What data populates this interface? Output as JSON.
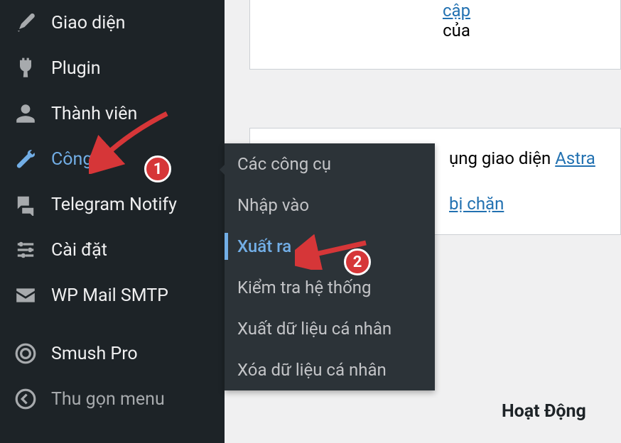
{
  "sidebar": {
    "appearance": "Giao diện",
    "plugins": "Plugin",
    "users": "Thành viên",
    "tools": "Công cụ",
    "telegram": "Telegram Notify",
    "settings": "Cài đặt",
    "wpmail": "WP Mail SMTP",
    "smush": "Smush Pro",
    "collapse": "Thu gọn menu"
  },
  "submenu": {
    "available_tools": "Các công cụ",
    "import": "Nhập vào",
    "export": "Xuất ra",
    "site_health": "Kiểm tra hệ thống",
    "export_personal": "Xuất dữ liệu cá nhân",
    "erase_personal": "Xóa dữ liệu cá nhân"
  },
  "content": {
    "update_link": "cập",
    "of": "của",
    "theme_text_suffix": "ụng giao diện ",
    "theme_link": "Astra",
    "blocked_link": "bị chặn",
    "activity_heading": "Hoạt Động"
  },
  "badges": {
    "one": "1",
    "two": "2"
  }
}
